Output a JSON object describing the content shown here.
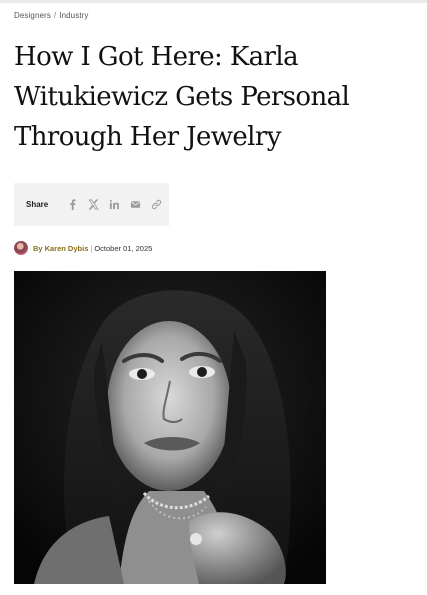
{
  "breadcrumb": {
    "items": [
      "Designers",
      "Industry"
    ],
    "separator": "/"
  },
  "article": {
    "title": "How I Got Here: Karla Witukiewicz Gets Personal Through Her Jewelry"
  },
  "share": {
    "label": "Share",
    "icons": [
      "facebook-icon",
      "x-icon",
      "linkedin-icon",
      "mail-icon",
      "link-icon"
    ]
  },
  "byline": {
    "prefix": "By",
    "author": "Karen Dybis",
    "separator": "|",
    "date": "October 01, 2025"
  },
  "colors": {
    "author_accent": "#8a6e1c",
    "share_background": "#f2f2f2",
    "icon_gray": "#9a9a9a"
  },
  "hero_image": {
    "alt": "Black and white portrait of Karla Witukiewicz"
  }
}
